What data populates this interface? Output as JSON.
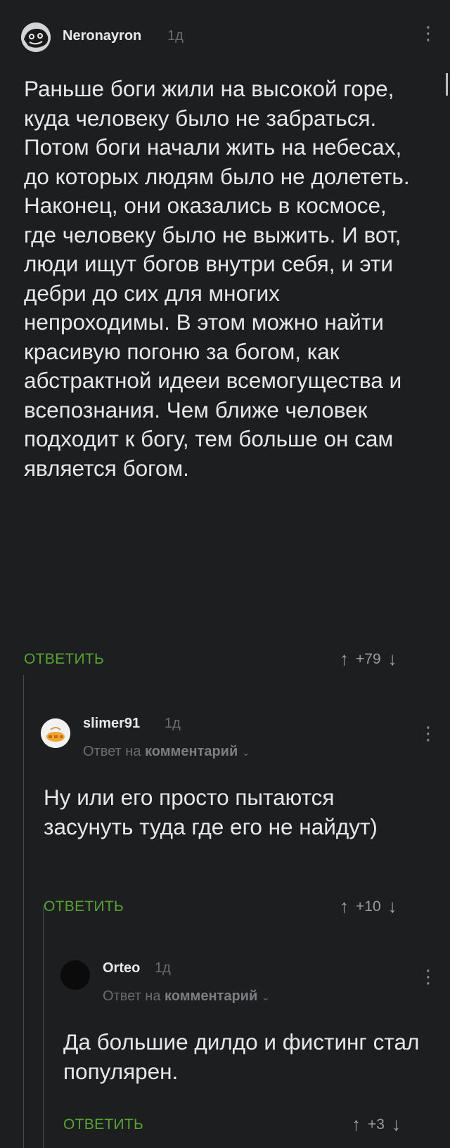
{
  "comments": [
    {
      "username": "Neronayron",
      "time": "1д",
      "reply_to": null,
      "body": "Раньше боги жили на высокой горе, куда человеку было не забраться. Потом боги начали жить на небесах, до которых людям было не долететь. Наконец, они оказались в космосе, где человеку было не выжить. И вот, люди ищут богов внутри себя, и эти дебри до сих для многих непроходимы. В этом можно найти красивую погоню за богом, как абстрактной идееи всемогущества и всепознания. Чем ближе человек подходит к богу, тем больше он сам является богом.",
      "reply_label": "ОТВЕТИТЬ",
      "rating": "+79"
    },
    {
      "username": "slimer91",
      "time": "1д",
      "reply_to_prefix": "Ответ на",
      "reply_to_target": "комментарий",
      "body": "Ну или его просто пытаются засунуть туда где его не найдут)",
      "reply_label": "ОТВЕТИТЬ",
      "rating": "+10"
    },
    {
      "username": "Orteo",
      "time": "1д",
      "reply_to_prefix": "Ответ на",
      "reply_to_target": "комментарий",
      "body": "Да большие дилдо и фистинг стал популярен.",
      "reply_label": "ОТВЕТИТЬ",
      "rating": "+3"
    }
  ],
  "icons": {
    "upvote": "up-arrow-icon",
    "downvote": "down-arrow-icon",
    "menu": "kebab-menu-icon",
    "expand": "chevron-down-icon"
  },
  "colors": {
    "background": "#1d1e20",
    "accent_green": "#58a234",
    "muted_text": "#6b6c6f"
  }
}
